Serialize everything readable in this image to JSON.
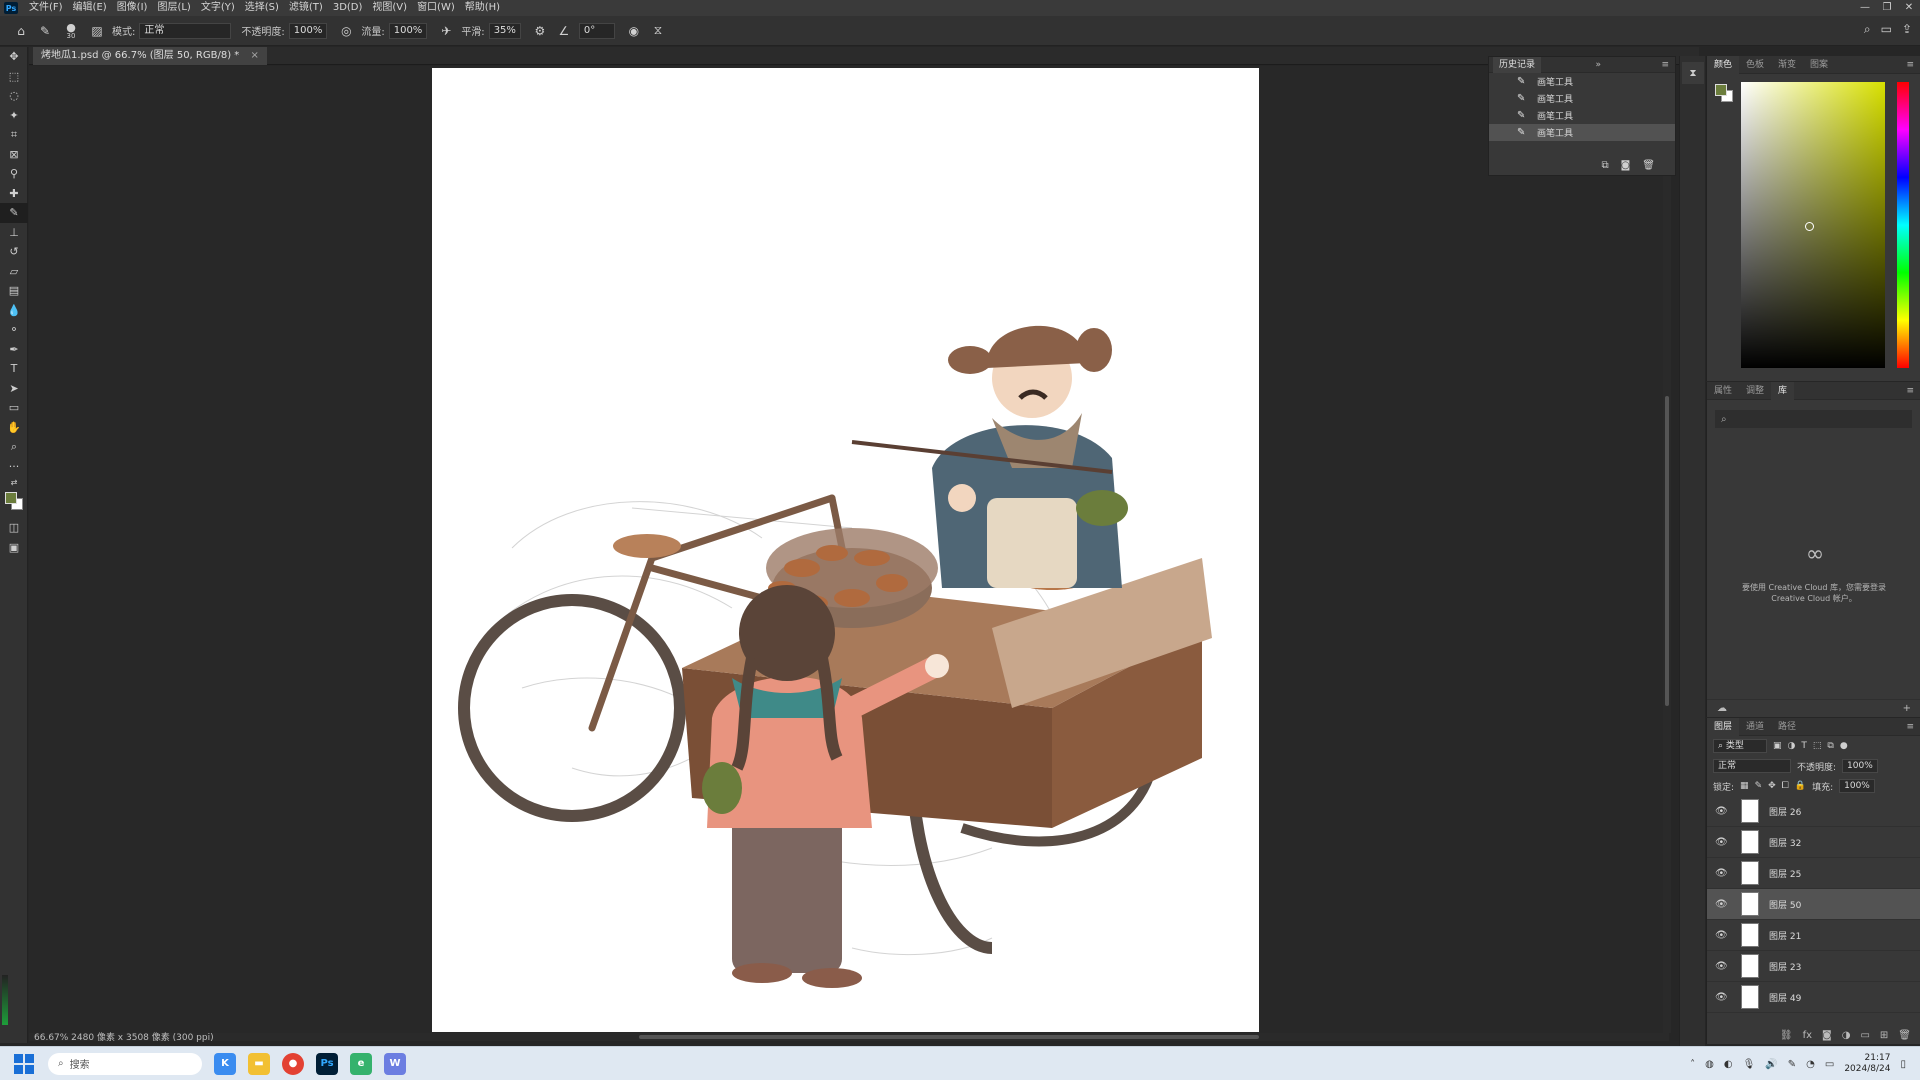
{
  "menubar": {
    "logo": "Ps",
    "items": [
      "文件(F)",
      "编辑(E)",
      "图像(I)",
      "图层(L)",
      "文字(Y)",
      "选择(S)",
      "滤镜(T)",
      "3D(D)",
      "视图(V)",
      "窗口(W)",
      "帮助(H)"
    ]
  },
  "window_controls": [
    "—",
    "❐",
    "✕"
  ],
  "options": {
    "home_icon": "home-icon",
    "brush_size": "30",
    "mode_label": "模式:",
    "mode_value": "正常",
    "opacity_label": "不透明度:",
    "opacity_value": "100%",
    "flow_label": "流量:",
    "flow_value": "100%",
    "smooth_label": "平滑:",
    "smooth_value": "35%",
    "angle_value": "0°"
  },
  "document": {
    "tab_title": "烤地瓜1.psd @ 66.7% (图层 50, RGB/8) *",
    "status": "66.67%   2480 像素 x 3508 像素 (300 ppi)"
  },
  "history": {
    "title": "历史记录",
    "items": [
      "画笔工具",
      "画笔工具",
      "画笔工具",
      "画笔工具"
    ],
    "selected_index": 3
  },
  "color_panel": {
    "tabs": [
      "颜色",
      "色板",
      "渐变",
      "图案"
    ],
    "foreground": "#6b7d3c",
    "background": "#ffffff"
  },
  "library_panel": {
    "tabs": [
      "属性",
      "调整",
      "库"
    ],
    "message": "要使用 Creative Cloud 库，您需要登录 Creative Cloud 帐户。"
  },
  "layers_panel": {
    "tabs": [
      "图层",
      "通道",
      "路径"
    ],
    "filter_label": "类型",
    "blend_mode": "正常",
    "opacity_label": "不透明度:",
    "opacity_value": "100%",
    "lock_label": "锁定:",
    "fill_label": "填充:",
    "fill_value": "100%",
    "layers": [
      "图层 26",
      "图层 32",
      "图层 25",
      "图层 50",
      "图层 21",
      "图层 23",
      "图层 49"
    ],
    "selected_index": 3
  },
  "taskbar": {
    "search_placeholder": "搜索",
    "time": "21:17",
    "date": "2024/8/24"
  }
}
